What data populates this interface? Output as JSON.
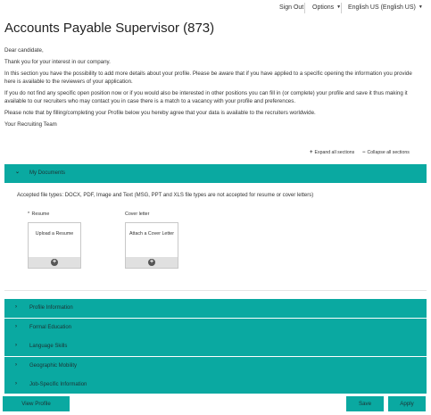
{
  "topnav": {
    "sign_out": "Sign Out",
    "options": "Options",
    "language": "English US (English US)"
  },
  "page": {
    "title": "Accounts Payable Supervisor (873)"
  },
  "intro": {
    "greeting": "Dear candidate,",
    "thanks": "Thank you for your interest in our company.",
    "p1": "In this section you have the possibility to add more details about your profile. Please be aware that if you have applied to a specific opening the information you provide here is available to the reviewers of your application.",
    "p2": "If you do not find any specific open position now or if you would also be interested in other positions you can fill in (or complete) your profile and save it thus making it available to our recruiters who may contact you in case there is a match to a vacancy with your profile and preferences.",
    "p3": "Please note that by filling/completing your Profile below you hereby agree that your data is available to the recruiters worldwide.",
    "signoff": "Your Recruiting Team"
  },
  "controls": {
    "expand_all": "Expand all sections",
    "collapse_all": "Collapse all sections"
  },
  "my_documents": {
    "header": "My Documents",
    "accepted_types": "Accepted file types: DOCX, PDF, Image and Text (MSG, PPT and XLS file types are not accepted for resume or cover letters)",
    "resume_label": "Resume",
    "resume_required_mark": "*",
    "resume_card": "Upload a Resume",
    "cover_label": "Cover letter",
    "cover_card": "Attach a Cover Letter"
  },
  "sections": [
    {
      "label": "Profile Information"
    },
    {
      "label": "Formal Education"
    },
    {
      "label": "Language Skills"
    },
    {
      "label": "Geographic Mobility"
    },
    {
      "label": "Job-Specific Information"
    }
  ],
  "footer": {
    "view_profile": "View Profile",
    "save": "Save",
    "apply": "Apply"
  },
  "colors": {
    "accent": "#0aa9a1"
  }
}
